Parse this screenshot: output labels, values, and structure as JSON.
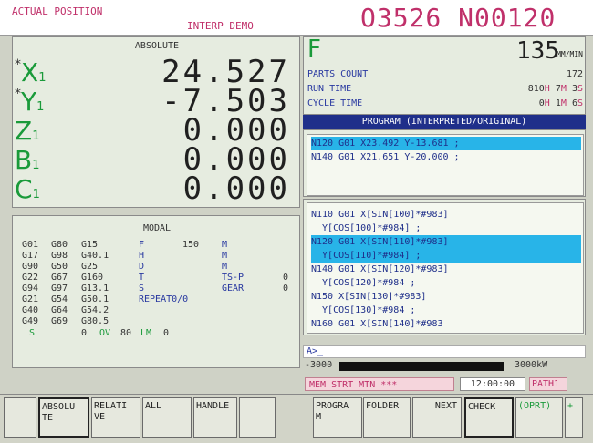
{
  "header": {
    "title": "ACTUAL POSITION",
    "mode": "INTERP DEMO",
    "program_number": "O3526",
    "sequence_number": "N00120"
  },
  "position": {
    "heading": "ABSOLUTE",
    "axes": [
      {
        "name": "X",
        "sub": "1",
        "marker": "*",
        "value": "24.527"
      },
      {
        "name": "Y",
        "sub": "1",
        "marker": "*",
        "value": "-7.503"
      },
      {
        "name": "Z",
        "sub": "1",
        "marker": "",
        "value": "0.000"
      },
      {
        "name": "B",
        "sub": "1",
        "marker": "",
        "value": "0.000"
      },
      {
        "name": "C",
        "sub": "1",
        "marker": "",
        "value": "0.000"
      }
    ]
  },
  "modal": {
    "heading": "MODAL",
    "g_rows": [
      [
        "G01",
        "G80",
        "G15"
      ],
      [
        "G17",
        "G98",
        "G40.1"
      ],
      [
        "G90",
        "G50",
        "G25"
      ],
      [
        "G22",
        "G67",
        "G160"
      ],
      [
        "G94",
        "G97",
        "G13.1"
      ],
      [
        "G21",
        "G54",
        "G50.1"
      ],
      [
        "G40",
        "G64",
        "G54.2"
      ],
      [
        "G49",
        "G69",
        "G80.5"
      ]
    ],
    "letters": [
      "F",
      "H",
      "D",
      "T",
      "S"
    ],
    "f_value": "150",
    "m_labels": [
      "M",
      "M",
      "M"
    ],
    "tsp_label": "TS-P",
    "tsp_value": "0",
    "gear_label": "GEAR",
    "gear_value": "0",
    "repeat": "REPEAT0/0",
    "bottom_s": "S",
    "bottom_s_value": "0",
    "bottom_ov": "OV",
    "bottom_ov_value": "80",
    "bottom_lm": "LM",
    "bottom_lm_value": "0"
  },
  "feed": {
    "label": "F",
    "value": "135",
    "unit": "MM/MIN"
  },
  "info": {
    "parts_count_label": "PARTS COUNT",
    "parts_count": "172",
    "run_time_label": "RUN TIME",
    "run_time_h": "810",
    "run_time_m": "7",
    "run_time_s": "3",
    "cycle_time_label": "CYCLE TIME",
    "cycle_time_h": "0",
    "cycle_time_m": "1",
    "cycle_time_s": "6",
    "unit_h": "H",
    "unit_m": "M",
    "unit_s": "S"
  },
  "program": {
    "header": "PROGRAM (INTERPRETED/ORIGINAL)",
    "interpreted": [
      {
        "text": "N120 G01 X23.492 Y-13.681 ;",
        "highlight": true
      },
      {
        "text": "N140 G01 X21.651 Y-20.000 ;",
        "highlight": false
      }
    ],
    "original": [
      {
        "text": "N110 G01 X[SIN[100]*#983]",
        "highlight": false
      },
      {
        "text": "  Y[COS[100]*#984] ;",
        "highlight": false
      },
      {
        "text": "N120 G01 X[SIN[110]*#983]",
        "highlight": true
      },
      {
        "text": "  Y[COS[110]*#984] ;",
        "highlight": true
      },
      {
        "text": "N140 G01 X[SIN[120]*#983]",
        "highlight": false
      },
      {
        "text": "  Y[COS[120]*#984 ;",
        "highlight": false
      },
      {
        "text": "N150 X[SIN[130]*#983]",
        "highlight": false
      },
      {
        "text": "  Y[COS[130]*#984 ;",
        "highlight": false
      },
      {
        "text": "N160 G01 X[SIN[140]*#983",
        "highlight": false
      }
    ]
  },
  "input_prompt": "A>_",
  "load": {
    "left": "-3000",
    "right": "3000kW"
  },
  "status": {
    "mode": "MEM STRT MTN ***",
    "time": "12:00:00",
    "path": "PATH1"
  },
  "softkeys": [
    {
      "label": "ABSOLU TE",
      "selected": true
    },
    {
      "label": "RELATI VE",
      "selected": false
    },
    {
      "label": "ALL",
      "selected": false
    },
    {
      "label": "HANDLE",
      "selected": false
    },
    {
      "label": "",
      "selected": false
    },
    {
      "label": "PROGRA M",
      "selected": false
    },
    {
      "label": "FOLDER",
      "selected": false
    },
    {
      "label": "NEXT",
      "selected": false
    },
    {
      "label": "CHECK",
      "selected": true
    },
    {
      "label": "(OPRT)",
      "selected": false
    },
    {
      "label": "+",
      "selected": false
    }
  ]
}
